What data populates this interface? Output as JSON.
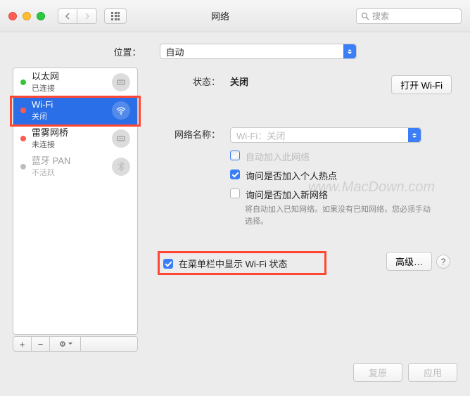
{
  "window": {
    "title": "网络"
  },
  "search": {
    "placeholder": "搜索"
  },
  "location": {
    "label": "位置：",
    "value": "自动"
  },
  "sidebar": {
    "items": [
      {
        "name": "以太网",
        "status": "已连接"
      },
      {
        "name": "Wi-Fi",
        "status": "关闭"
      },
      {
        "name": "雷雾网桥",
        "status": "未连接"
      },
      {
        "name": "蓝牙 PAN",
        "status": "不活跃"
      }
    ],
    "footer": {
      "add": "+",
      "remove": "−",
      "gear": "✻▾"
    }
  },
  "main": {
    "status_label": "状态：",
    "status_value": "关闭",
    "wifi_button": "打开 Wi-Fi",
    "network_name_label": "网络名称：",
    "network_name_value": "Wi-Fi：关闭",
    "auto_join_label": "自动加入此网络",
    "ask_hotspot_label": "询问是否加入个人热点",
    "ask_new_label": "询问是否加入新网络",
    "ask_new_hint": "将自动加入已知网络。如果没有已知网络，您必须手动选择。",
    "menubar_label": "在菜单栏中显示 Wi-Fi 状态",
    "advanced_button": "高级…",
    "help": "?"
  },
  "footer": {
    "revert": "复原",
    "apply": "应用"
  },
  "watermark": "www.MacDown.com"
}
